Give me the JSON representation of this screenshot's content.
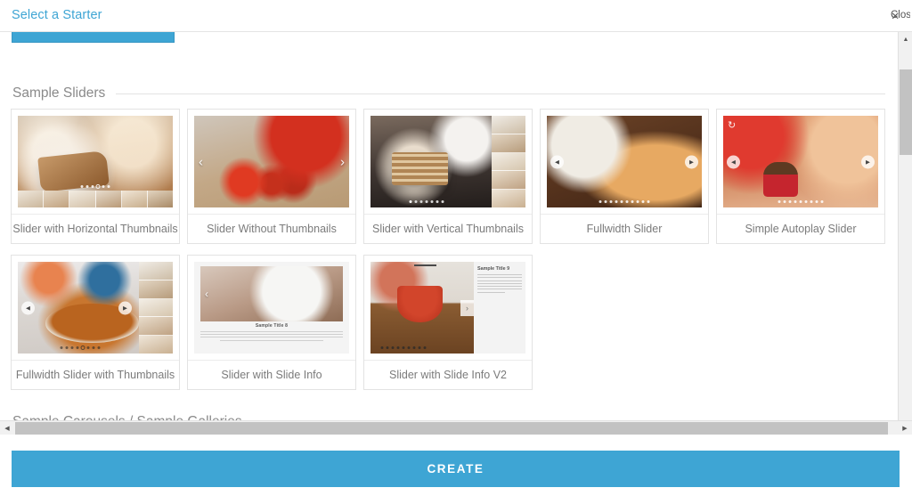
{
  "window": {
    "title": "Select a Starter",
    "close_label": "Close",
    "close_icon": "close-icon"
  },
  "sections": [
    {
      "title": "Sample Sliders",
      "cards": [
        {
          "label": "Slider with Horizontal Thumbnails",
          "style": "horizontal-thumbnails",
          "image": "cake-slice"
        },
        {
          "label": "Slider Without Thumbnails",
          "style": "plain-arrows",
          "image": "strawberries"
        },
        {
          "label": "Slider with Vertical Thumbnails",
          "style": "vertical-thumbnails",
          "image": "layer-cake-coffee"
        },
        {
          "label": "Fullwidth Slider",
          "style": "round-arrows-dots",
          "image": "pastries"
        },
        {
          "label": "Simple Autoplay Slider",
          "style": "autoplay-dots",
          "image": "cupcake"
        },
        {
          "label": "Fullwidth Slider with Thumbnails",
          "style": "fullwidth-thumbnails",
          "image": "pizza"
        },
        {
          "label": "Slider with Slide Info",
          "style": "caption-below",
          "image": "salad-bowl"
        },
        {
          "label": "Slider with Slide Info V2",
          "style": "side-info",
          "image": "strawberry-bowl"
        }
      ]
    }
  ],
  "slide_captions": {
    "caption_below_title": "Sample Title 8",
    "side_info_title": "Sample Title 9"
  },
  "next_section": {
    "title": "Sample Carousels / Sample Galleries"
  },
  "footer": {
    "create_label": "CREATE"
  },
  "scrollbars": {
    "up_arrow": "▲",
    "down_arrow": "▼",
    "left_arrow": "◀",
    "right_arrow": "▶"
  },
  "colors": {
    "accent": "#3ea5d4",
    "heading": "#8a8a8a",
    "card_label": "#7b7b7b",
    "border": "#e3e3e3",
    "scrollbar_thumb": "#c2c2c2"
  }
}
